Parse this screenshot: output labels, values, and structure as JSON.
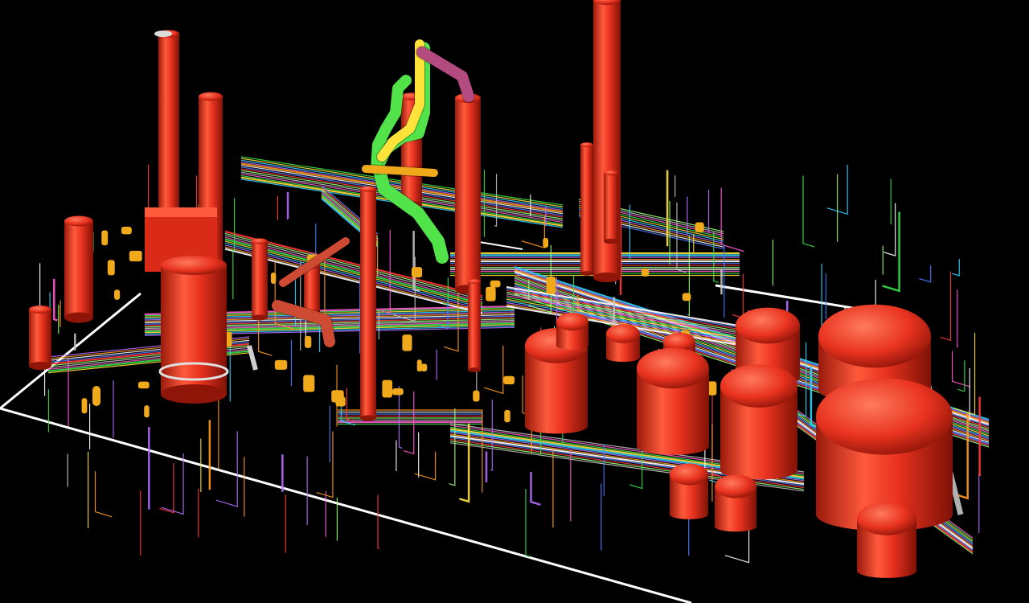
{
  "scene": {
    "background": "#000000",
    "site_outline_color": "#ffffff",
    "vessel_color": "#e8321f",
    "vessel_highlight": "#ff6a4d",
    "vessel_shade": "#8e1508",
    "pipe_colors": [
      "#ff5ad0",
      "#39e04a",
      "#ffe23a",
      "#2fd3ff",
      "#b46bff",
      "#ff9a1f",
      "#ffffff",
      "#4f7dff",
      "#ff3a3a",
      "#9aff7a",
      "#c2c2c2"
    ],
    "equipment_color": "#f0a91a",
    "icons": [
      "plant-3d-model",
      "distillation-column-icon",
      "storage-tank-icon",
      "stack-icon",
      "pipe-rack-icon"
    ]
  }
}
